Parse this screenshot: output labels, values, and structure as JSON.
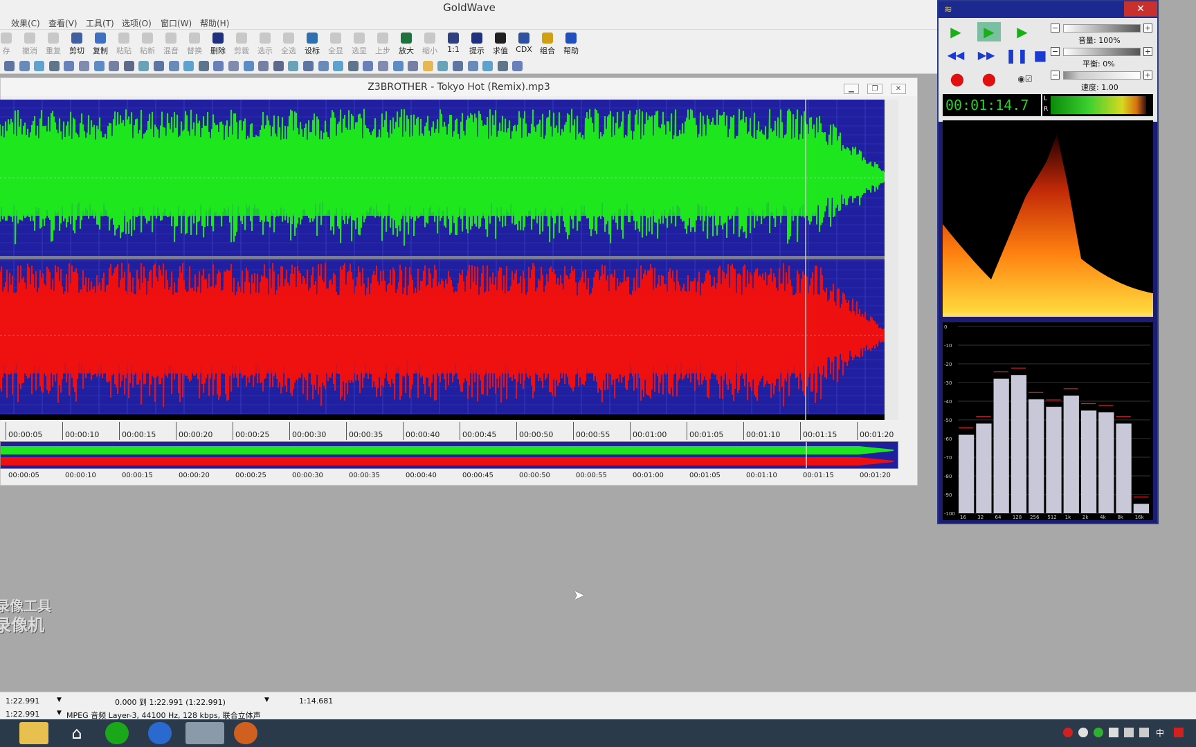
{
  "app": {
    "title": "GoldWave"
  },
  "menu": [
    "效果(C)",
    "查看(V)",
    "工具(T)",
    "选项(O)",
    "窗口(W)",
    "帮助(H)"
  ],
  "toolbar": [
    {
      "label": "存",
      "icon": "save-icon",
      "enabled": false
    },
    {
      "label": "撤消",
      "icon": "undo-icon",
      "enabled": false
    },
    {
      "label": "重复",
      "icon": "redo-icon",
      "enabled": false
    },
    {
      "label": "剪切",
      "icon": "cut-icon",
      "enabled": true
    },
    {
      "label": "复制",
      "icon": "copy-icon",
      "enabled": true
    },
    {
      "label": "粘贴",
      "icon": "paste-icon",
      "enabled": false
    },
    {
      "label": "粘新",
      "icon": "paste-new-icon",
      "enabled": false
    },
    {
      "label": "混音",
      "icon": "mix-icon",
      "enabled": false
    },
    {
      "label": "替换",
      "icon": "replace-icon",
      "enabled": false
    },
    {
      "label": "删除",
      "icon": "delete-icon",
      "enabled": true
    },
    {
      "label": "剪裁",
      "icon": "trim-icon",
      "enabled": false
    },
    {
      "label": "选示",
      "icon": "show-selection-icon",
      "enabled": false
    },
    {
      "label": "全选",
      "icon": "select-all-icon",
      "enabled": false
    },
    {
      "label": "设标",
      "icon": "set-marker-icon",
      "enabled": true
    },
    {
      "label": "全显",
      "icon": "show-all-icon",
      "enabled": false
    },
    {
      "label": "选显",
      "icon": "zoom-selection-icon",
      "enabled": false
    },
    {
      "label": "上步",
      "icon": "previous-zoom-icon",
      "enabled": false
    },
    {
      "label": "放大",
      "icon": "zoom-in-icon",
      "enabled": true
    },
    {
      "label": "缩小",
      "icon": "zoom-out-icon",
      "enabled": false
    },
    {
      "label": "1:1",
      "icon": "zoom-1to1-icon",
      "enabled": true
    },
    {
      "label": "提示",
      "icon": "cue-icon",
      "enabled": true
    },
    {
      "label": "求值",
      "icon": "evaluate-icon",
      "enabled": true
    },
    {
      "label": "CDX",
      "icon": "cd-extract-icon",
      "enabled": true
    },
    {
      "label": "组合",
      "icon": "combine-icon",
      "enabled": true
    },
    {
      "label": "帮助",
      "icon": "help-icon",
      "enabled": true
    }
  ],
  "document": {
    "title": "Z3BROTHER - Tokyo Hot (Remix).mp3"
  },
  "timeline": {
    "ticks": [
      "00:00:05",
      "00:00:10",
      "00:00:15",
      "00:00:20",
      "00:00:25",
      "00:00:30",
      "00:00:35",
      "00:00:40",
      "00:00:45",
      "00:00:50",
      "00:00:55",
      "00:01:00",
      "00:01:05",
      "00:01:10",
      "00:01:15",
      "00:01:20"
    ],
    "playhead_fraction": 0.897
  },
  "control": {
    "volume_label": "音量: 100%",
    "balance_label": "平衡: 0%",
    "speed_label": "速度: 1.00",
    "time_display": "00:01:14.7",
    "meter_l": "L",
    "meter_r": "R",
    "db_labels": [
      "0",
      "-10",
      "-20",
      "-30",
      "-40",
      "-50",
      "-60",
      "-70",
      "-80",
      "-90",
      "-100"
    ],
    "freq_labels": [
      "16",
      "32",
      "64",
      "128",
      "256",
      "512",
      "1k",
      "2k",
      "4k",
      "8k",
      "16k"
    ],
    "band_levels_db": [
      -58,
      -52,
      -28,
      -26,
      -39,
      -43,
      -37,
      -45,
      -46,
      -52,
      -95
    ]
  },
  "status": {
    "row1": {
      "length": "1:22.991",
      "selection": "0.000 到 1:22.991 (1:22.991)",
      "position": "1:14.681"
    },
    "row2": {
      "length": "1:22.991",
      "format": "MPEG 音频 Layer-3, 44100 Hz, 128 kbps, 联合立体声"
    }
  },
  "watermark": [
    "屏幕录像工具",
    "屏幕录像机"
  ],
  "colors": {
    "left_channel": "#1ee61e",
    "right_channel": "#ee1010",
    "wave_bg": "#1f1fa0"
  }
}
